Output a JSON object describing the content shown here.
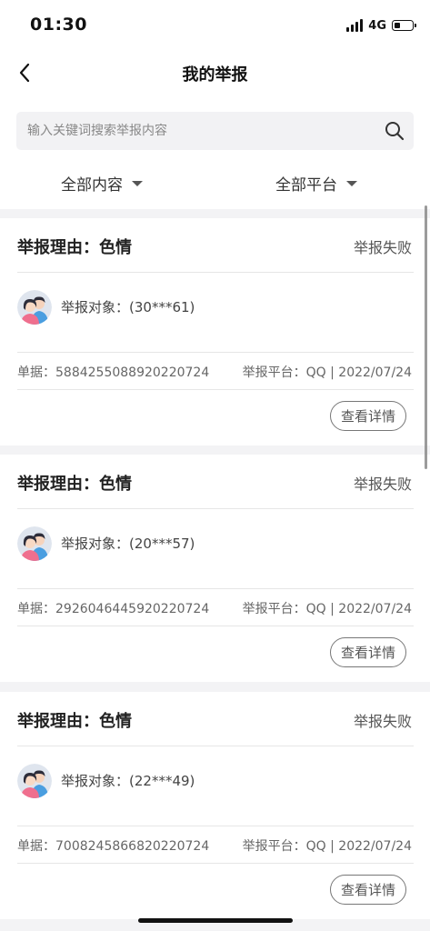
{
  "status_bar": {
    "time": "01:30",
    "network": "4G",
    "icons": [
      "signal-icon",
      "battery-icon"
    ]
  },
  "nav": {
    "back_icon": "chevron-left-icon",
    "title": "我的举报"
  },
  "search": {
    "placeholder": "输入关键词搜索举报内容",
    "value": "",
    "icon": "search-icon"
  },
  "filters": {
    "content": {
      "label": "全部内容",
      "icon": "caret-down-icon"
    },
    "platform": {
      "label": "全部平台",
      "icon": "caret-down-icon"
    }
  },
  "reports": [
    {
      "reason": "举报理由：色情",
      "status": "举报失败",
      "target": "举报对象：(30***61)",
      "ticket": "单据：5884255088920220724",
      "platform": "举报平台：QQ | 2022/07/24",
      "detail_label": "查看详情"
    },
    {
      "reason": "举报理由：色情",
      "status": "举报失败",
      "target": "举报对象：(20***57)",
      "ticket": "单据：2926046445920220724",
      "platform": "举报平台：QQ | 2022/07/24",
      "detail_label": "查看详情"
    },
    {
      "reason": "举报理由：色情",
      "status": "举报失败",
      "target": "举报对象：(22***49)",
      "ticket": "单据：7008245866820220724",
      "platform": "举报平台：QQ | 2022/07/24",
      "detail_label": "查看详情"
    }
  ],
  "colors": {
    "background": "#f3f3f5",
    "card": "#ffffff",
    "title_text": "#222222",
    "muted_text": "#666666"
  }
}
